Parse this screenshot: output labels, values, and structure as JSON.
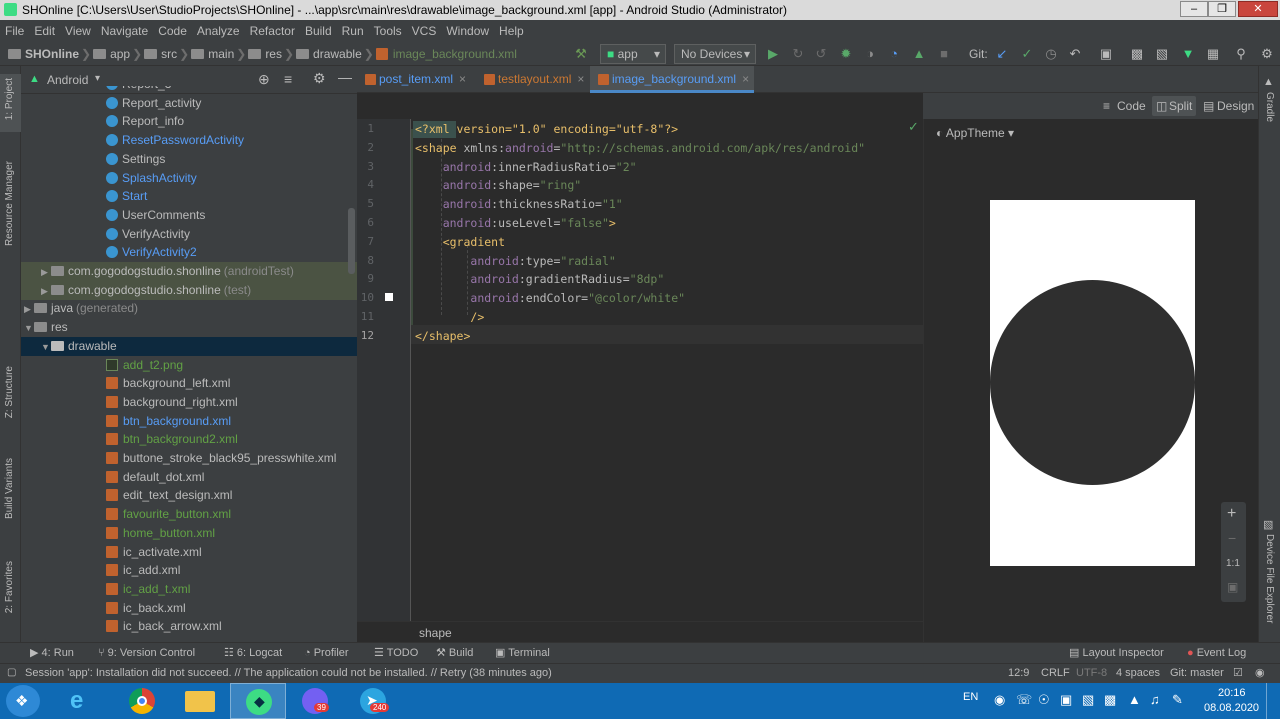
{
  "window": {
    "title": "SHOnline [C:\\Users\\User\\StudioProjects\\SHOnline] - ...\\app\\src\\main\\res\\drawable\\image_background.xml [app] - Android Studio (Administrator)",
    "minimize": "0",
    "maximize": "1",
    "close": "r"
  },
  "menu": [
    "File",
    "Edit",
    "View",
    "Navigate",
    "Code",
    "Analyze",
    "Refactor",
    "Build",
    "Run",
    "Tools",
    "VCS",
    "Window",
    "Help"
  ],
  "breadcrumb": [
    "SHOnline",
    "app",
    "src",
    "main",
    "res",
    "drawable",
    "image_background.xml"
  ],
  "toolbar": {
    "config": "app",
    "device": "No Devices",
    "git_label": "Git:"
  },
  "left_stripe": [
    "1: Project",
    "Resource Manager",
    "Z: Structure",
    "Build Variants",
    "2: Favorites"
  ],
  "project": {
    "view_mode": "Android",
    "rows": [
      {
        "text": "Report_3",
        "icon": "class",
        "color": "normal",
        "depth": 5
      },
      {
        "text": "Report_activity",
        "icon": "class",
        "color": "normal",
        "depth": 5
      },
      {
        "text": "Report_info",
        "icon": "class",
        "color": "normal",
        "depth": 5
      },
      {
        "text": "ResetPasswordActivity",
        "icon": "class",
        "color": "blue",
        "depth": 5
      },
      {
        "text": "Settings",
        "icon": "class",
        "color": "normal",
        "depth": 5
      },
      {
        "text": "SplashActivity",
        "icon": "class",
        "color": "blue",
        "depth": 5
      },
      {
        "text": "Start",
        "icon": "class",
        "color": "blue",
        "depth": 5
      },
      {
        "text": "UserComments",
        "icon": "class",
        "color": "normal",
        "depth": 5
      },
      {
        "text": "VerifyActivity",
        "icon": "class",
        "color": "normal",
        "depth": 5
      },
      {
        "text": "VerifyActivity2",
        "icon": "class",
        "color": "blue",
        "depth": 5
      },
      {
        "text": "com.gogodogstudio.shonline",
        "suffix": "(androidTest)",
        "icon": "package",
        "color": "normal",
        "depth": 2,
        "arrow": "right",
        "hl": true
      },
      {
        "text": "com.gogodogstudio.shonline",
        "suffix": "(test)",
        "icon": "package",
        "color": "normal",
        "depth": 2,
        "arrow": "right",
        "hl": true
      },
      {
        "text": "java",
        "suffix": "(generated)",
        "icon": "folder",
        "color": "normal",
        "depth": 1,
        "arrow": "right"
      },
      {
        "text": "res",
        "icon": "folder",
        "color": "normal",
        "depth": 1,
        "arrow": "down"
      },
      {
        "text": "drawable",
        "icon": "folder",
        "color": "normal",
        "depth": 2,
        "arrow": "down",
        "sel": true
      },
      {
        "text": "add_t2.png",
        "icon": "png",
        "color": "green",
        "depth": 5
      },
      {
        "text": "background_left.xml",
        "icon": "xml",
        "color": "normal",
        "depth": 5
      },
      {
        "text": "background_right.xml",
        "icon": "xml",
        "color": "normal",
        "depth": 5
      },
      {
        "text": "btn_background.xml",
        "icon": "xml",
        "color": "blue",
        "depth": 5
      },
      {
        "text": "btn_background2.xml",
        "icon": "xml",
        "color": "green",
        "depth": 5
      },
      {
        "text": "buttone_stroke_black95_presswhite.xml",
        "icon": "xml",
        "color": "normal",
        "depth": 5
      },
      {
        "text": "default_dot.xml",
        "icon": "xml",
        "color": "normal",
        "depth": 5
      },
      {
        "text": "edit_text_design.xml",
        "icon": "xml",
        "color": "normal",
        "depth": 5
      },
      {
        "text": "favourite_button.xml",
        "icon": "xml",
        "color": "green",
        "depth": 5
      },
      {
        "text": "home_button.xml",
        "icon": "xml",
        "color": "green",
        "depth": 5
      },
      {
        "text": "ic_activate.xml",
        "icon": "xml",
        "color": "normal",
        "depth": 5
      },
      {
        "text": "ic_add.xml",
        "icon": "xml",
        "color": "normal",
        "depth": 5
      },
      {
        "text": "ic_add_t.xml",
        "icon": "xml",
        "color": "green",
        "depth": 5
      },
      {
        "text": "ic_back.xml",
        "icon": "xml",
        "color": "normal",
        "depth": 5
      },
      {
        "text": "ic_back_arrow.xml",
        "icon": "xml",
        "color": "normal",
        "depth": 5
      }
    ]
  },
  "editor_tabs": [
    {
      "label": "post_item.xml",
      "color": "#589df6",
      "active": false
    },
    {
      "label": "testlayout.xml",
      "color": "#cc7832",
      "active": false
    },
    {
      "label": "image_background.xml",
      "color": "#589df6",
      "active": true
    }
  ],
  "view_modes": {
    "code": "Code",
    "split": "Split",
    "design": "Design"
  },
  "theme": "AppTheme",
  "code_lines": [
    [
      [
        "pi",
        "<?xml version=\"1.0\" encoding=\"utf-8\"?>"
      ]
    ],
    [
      [
        "tag",
        "<shape "
      ],
      [
        "attr",
        "xmlns:"
      ],
      [
        "attr-ns",
        "android"
      ],
      [
        "attr",
        "="
      ],
      [
        "str",
        "\"http://schemas.android.com/apk/res/android\""
      ]
    ],
    [
      [
        "txt",
        "    "
      ],
      [
        "attr-ns",
        "android"
      ],
      [
        "attr",
        ":innerRadiusRatio="
      ],
      [
        "str",
        "\"2\""
      ]
    ],
    [
      [
        "txt",
        "    "
      ],
      [
        "attr-ns",
        "android"
      ],
      [
        "attr",
        ":shape="
      ],
      [
        "str",
        "\"ring\""
      ]
    ],
    [
      [
        "txt",
        "    "
      ],
      [
        "attr-ns",
        "android"
      ],
      [
        "attr",
        ":thicknessRatio="
      ],
      [
        "str",
        "\"1\""
      ]
    ],
    [
      [
        "txt",
        "    "
      ],
      [
        "attr-ns",
        "android"
      ],
      [
        "attr",
        ":useLevel="
      ],
      [
        "str",
        "\"false\""
      ],
      [
        "tag",
        ">"
      ]
    ],
    [
      [
        "txt",
        "    "
      ],
      [
        "tag",
        "<gradient"
      ]
    ],
    [
      [
        "txt",
        "        "
      ],
      [
        "attr-ns",
        "android"
      ],
      [
        "attr",
        ":type="
      ],
      [
        "str",
        "\"radial\""
      ]
    ],
    [
      [
        "txt",
        "        "
      ],
      [
        "attr-ns",
        "android"
      ],
      [
        "attr",
        ":gradientRadius="
      ],
      [
        "str",
        "\"8dp\""
      ]
    ],
    [
      [
        "txt",
        "        "
      ],
      [
        "attr-ns",
        "android"
      ],
      [
        "attr",
        ":endColor="
      ],
      [
        "str",
        "\"@color/white\""
      ]
    ],
    [
      [
        "txt",
        "        "
      ],
      [
        "tag",
        "/>"
      ]
    ],
    [
      [
        "tag",
        "</shape>"
      ]
    ]
  ],
  "editor_breadcrumb": "shape",
  "right_stripe": [
    "Gradle",
    "Device File Explorer"
  ],
  "zoom": {
    "plus": "+",
    "minus": "−",
    "one_to_one": "1:1"
  },
  "bottom_tabs": [
    {
      "label": "4: Run",
      "icon": "run-icon"
    },
    {
      "label": "9: Version Control",
      "icon": "vcs-icon"
    },
    {
      "label": "6: Logcat",
      "icon": "logcat-icon"
    },
    {
      "label": "Profiler",
      "icon": "profiler-icon"
    },
    {
      "label": "TODO",
      "icon": "todo-icon"
    },
    {
      "label": "Build",
      "icon": "build-icon"
    },
    {
      "label": "Terminal",
      "icon": "terminal-icon"
    },
    {
      "label": "Layout Inspector",
      "icon": "layout-inspector-icon"
    },
    {
      "label": "Event Log",
      "icon": "event-log-icon"
    }
  ],
  "status": {
    "message": "Session 'app': Installation did not succeed. // The application could not be installed. // Retry (38 minutes ago)",
    "position": "12:9",
    "line_sep": "CRLF",
    "encoding": "UTF-8",
    "indent": "4 spaces",
    "branch": "Git: master"
  },
  "taskbar": {
    "lang": "EN",
    "time": "20:16",
    "date": "08.08.2020",
    "viber_badge": "39",
    "telegram_badge": "240"
  }
}
